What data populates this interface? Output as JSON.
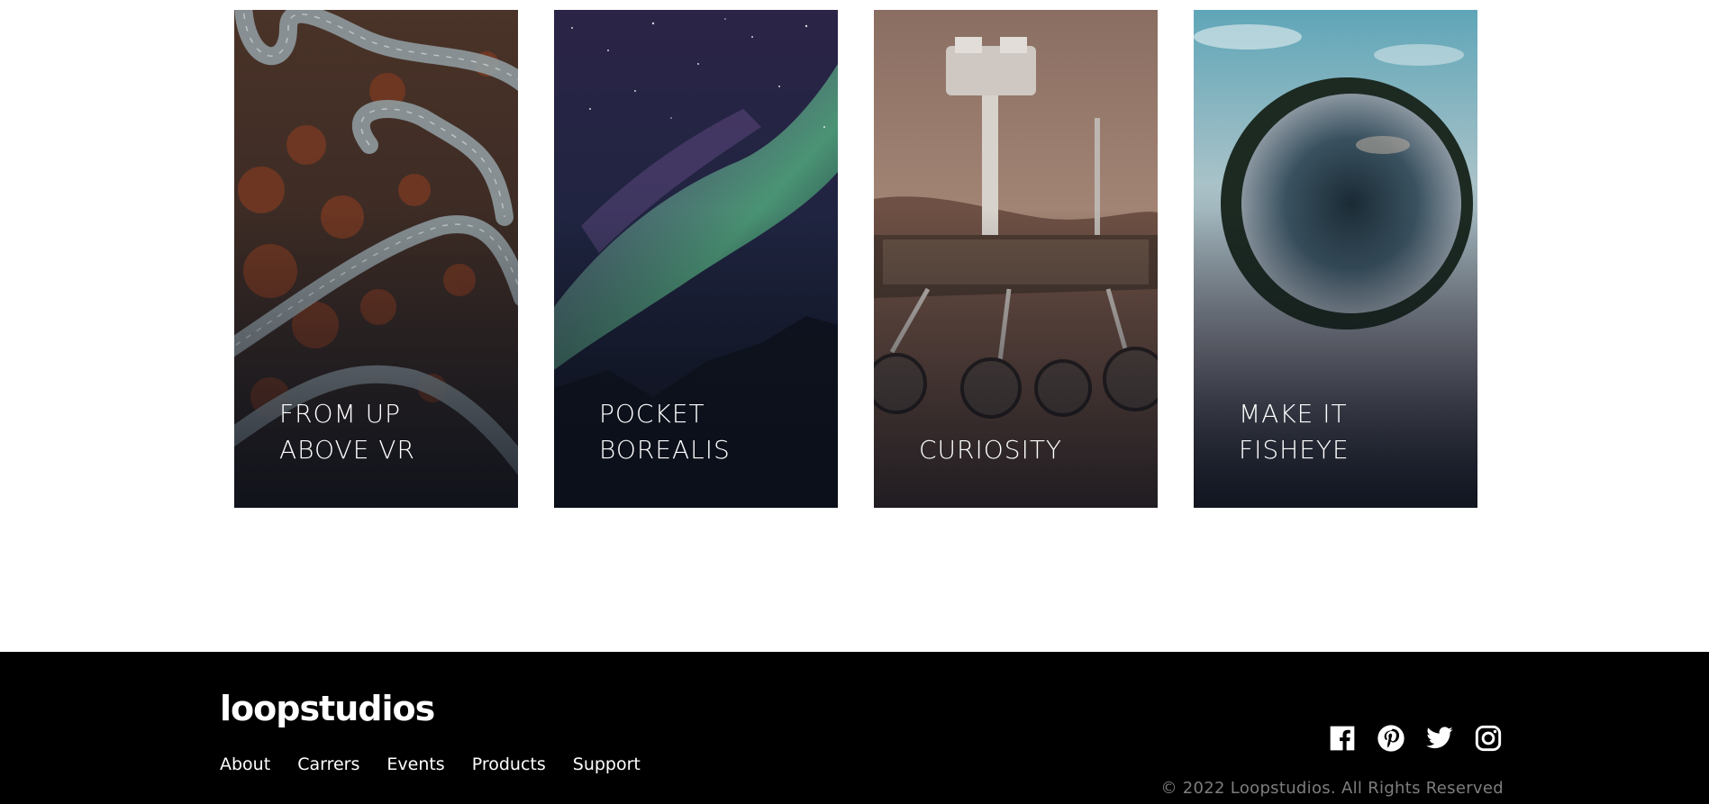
{
  "cards": [
    {
      "line1": "FROM UP",
      "line2": "ABOVE VR"
    },
    {
      "line1": "POCKET",
      "line2": "BOREALIS"
    },
    {
      "line1": "",
      "line2": "CURIOSITY"
    },
    {
      "line1": "MAKE IT",
      "line2": "FISHEYE"
    }
  ],
  "footer": {
    "logo": "loopstudios",
    "nav": [
      "About",
      "Carrers",
      "Events",
      "Products",
      "Support"
    ],
    "copyright": "© 2022 Loopstudios. All Rights Reserved",
    "socials": [
      "facebook-icon",
      "pinterest-icon",
      "twitter-icon",
      "instagram-icon"
    ]
  },
  "colors": {
    "footer_bg": "#000000",
    "page_bg": "#ffffff",
    "copyright_text": "#7d7d7d",
    "text": "#ffffff"
  }
}
